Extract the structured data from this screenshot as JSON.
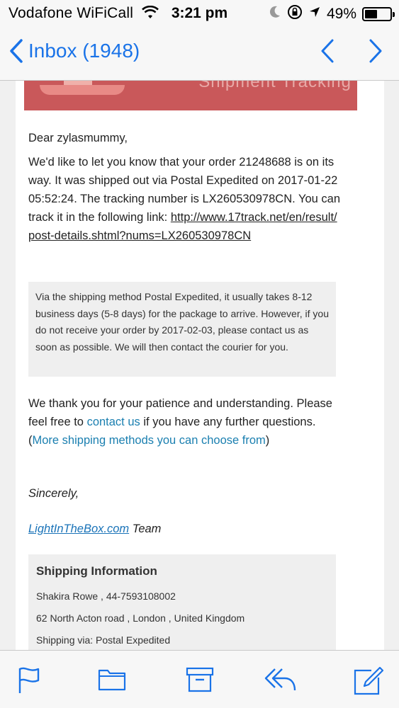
{
  "status": {
    "carrier": "Vodafone WiFiCall",
    "time": "3:21 pm",
    "battery": "49%",
    "battery_level": 0.49,
    "icons": [
      "wifi-icon",
      "moon-icon",
      "rotation-lock-icon",
      "location-arrow-icon",
      "battery-icon"
    ]
  },
  "nav": {
    "back_label": "Inbox (1948)",
    "accent": "#1a73e8"
  },
  "banner": {
    "text": "Shipment Tracking"
  },
  "email": {
    "greeting": "Dear zylasmummy,",
    "para1_text": "We'd like to let you know that your order 21248688 is on its way. It was shipped out via Postal Expedited on 2017-01-22 05:52:24. The tracking number is LX260530978CN. You can track it in the following link: ",
    "tracking_link": "http://www.17track.net/en/result/post-details.shtml?nums=LX260530978CN",
    "notice": "Via the shipping method Postal Expedited, it usually takes 8-12 business days (5-8 days) for the package to arrive. However, if you do not receive your order by 2017-02-03, please contact us as soon as possible. We will then contact the courier for you.",
    "thanks_1": "We thank you for your patience and understanding. Please feel free to ",
    "contact_link": "contact us",
    "thanks_2": " if you have any further questions. (",
    "methods_link": "More shipping methods you can choose from",
    "thanks_3": ")",
    "sincerely": "Sincerely,",
    "company_link": "LightInTheBox.com",
    "team_suffix": " Team",
    "link_color": "#1a7fb0"
  },
  "shipping": {
    "title": "Shipping Information",
    "contact": "Shakira Rowe , 44-7593108002",
    "address": "62 North Acton road , London , United Kingdom",
    "via": "Shipping via: Postal Expedited"
  },
  "toolbar": {
    "icons": [
      "flag-icon",
      "folder-icon",
      "archive-icon",
      "reply-icon",
      "compose-icon"
    ]
  }
}
